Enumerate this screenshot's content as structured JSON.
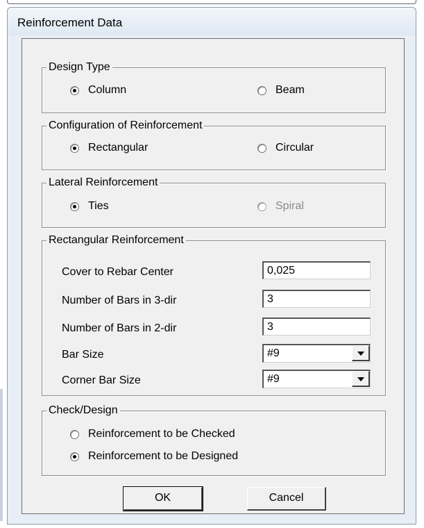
{
  "window": {
    "title": "Reinforcement Data"
  },
  "design_type": {
    "legend": "Design Type",
    "options": [
      {
        "label": "Column",
        "selected": true
      },
      {
        "label": "Beam",
        "selected": false
      }
    ]
  },
  "configuration": {
    "legend": "Configuration of Reinforcement",
    "options": [
      {
        "label": "Rectangular",
        "selected": true
      },
      {
        "label": "Circular",
        "selected": false
      }
    ]
  },
  "lateral": {
    "legend": "Lateral Reinforcement",
    "options": [
      {
        "label": "Ties",
        "selected": true
      },
      {
        "label": "Spiral",
        "selected": false,
        "disabled": true
      }
    ]
  },
  "rectangular": {
    "legend": "Rectangular Reinforcement",
    "fields": [
      {
        "label": "Cover to Rebar Center",
        "value": "0,025"
      },
      {
        "label": "Number of Bars in 3-dir",
        "value": "3"
      },
      {
        "label": "Number of Bars in 2-dir",
        "value": "3"
      },
      {
        "label": "Bar Size",
        "value": "#9"
      },
      {
        "label": "Corner Bar Size",
        "value": "#9"
      }
    ]
  },
  "check_design": {
    "legend": "Check/Design",
    "options": [
      {
        "label": "Reinforcement to be Checked",
        "selected": false
      },
      {
        "label": "Reinforcement to be Designed",
        "selected": true
      }
    ]
  },
  "buttons": {
    "ok": "OK",
    "cancel": "Cancel"
  }
}
